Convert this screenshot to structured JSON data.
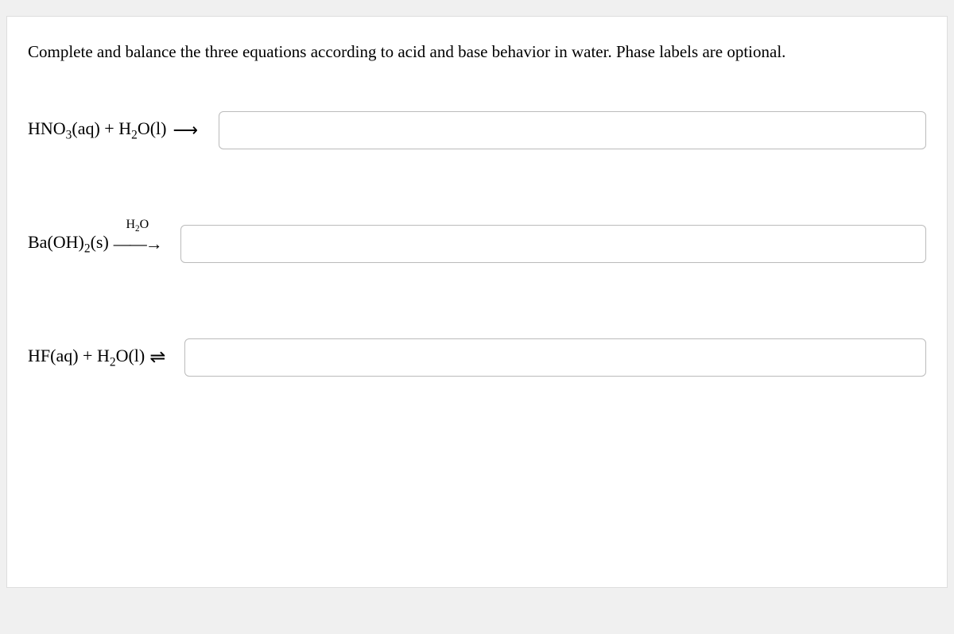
{
  "question": "Complete and balance the three equations according to acid and base behavior in water. Phase labels are optional.",
  "equations": {
    "eq1": {
      "reactant1": "HNO",
      "sub1": "3",
      "phase1": "(aq)",
      "plus": " + ",
      "reactant2": "H",
      "sub2": "2",
      "reactant2b": "O(l)",
      "arrow_text": "⟶",
      "input_value": ""
    },
    "eq2": {
      "reactant1": "Ba(OH)",
      "sub1": "2",
      "phase1": "(s)",
      "arrow_label_h": "H",
      "arrow_label_sub": "2",
      "arrow_label_o": "O",
      "arrow_text": "⟶",
      "input_value": ""
    },
    "eq3": {
      "reactant1": "HF(aq)",
      "plus": " + ",
      "reactant2": "H",
      "sub2": "2",
      "reactant2b": "O(l)",
      "equilibrium": "⇌",
      "input_value": ""
    }
  }
}
